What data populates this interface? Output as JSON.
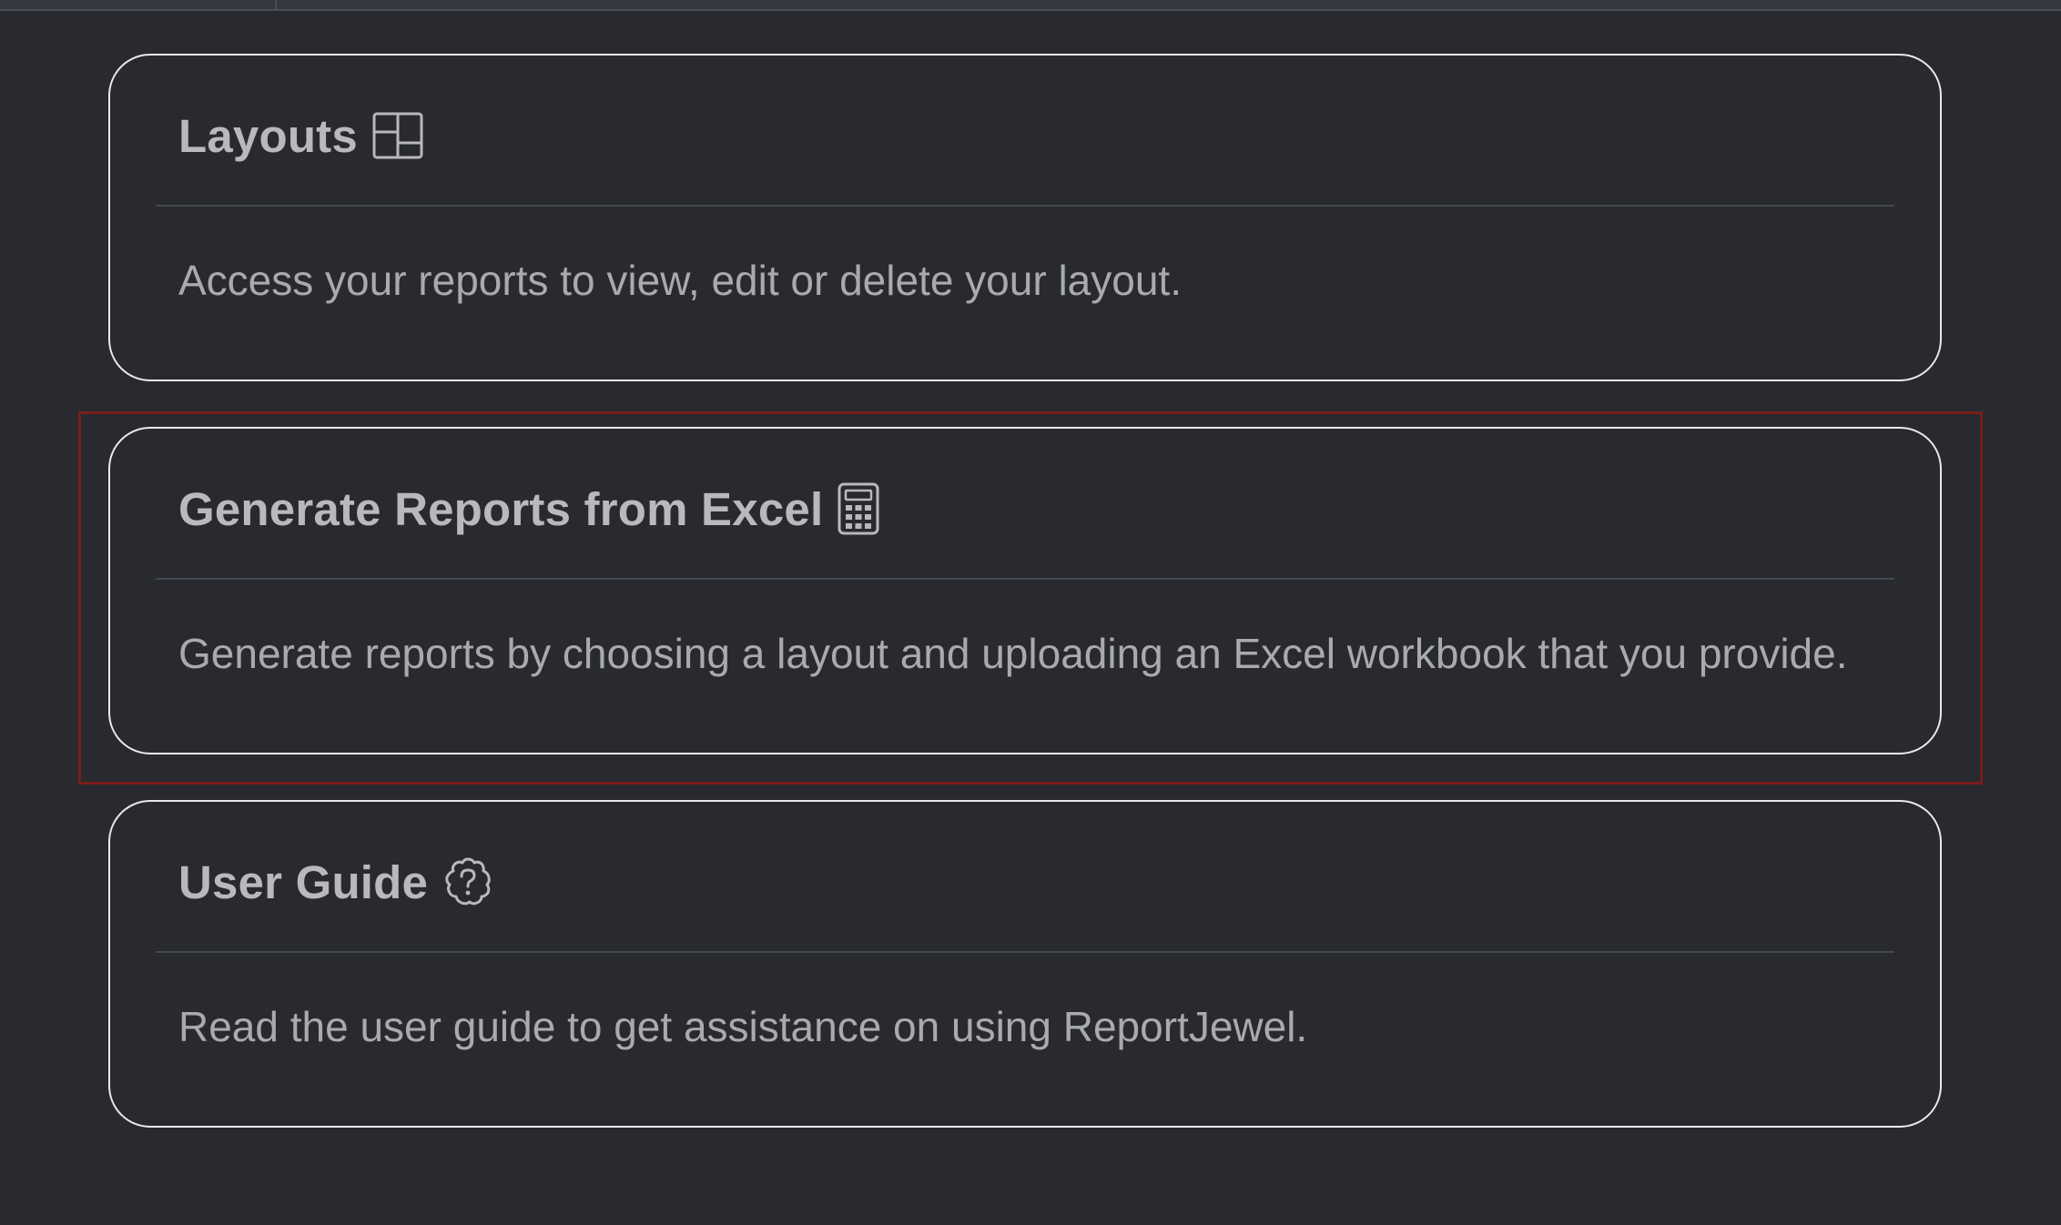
{
  "cards": [
    {
      "title": "Layouts",
      "icon": "layout-icon",
      "description": "Access your reports to view, edit or delete your layout."
    },
    {
      "title": "Generate Reports from Excel",
      "icon": "calculator-icon",
      "description": "Generate reports by choosing a layout and uploading an Excel workbook that you provide."
    },
    {
      "title": "User Guide",
      "icon": "help-badge-icon",
      "description": "Read the user guide to get assistance on using ReportJewel."
    }
  ],
  "colors": {
    "background": "#282a2f",
    "card_border": "#e9e9ea",
    "title_text": "#b9b9bb",
    "desc_text": "#a9aaac",
    "highlight": "#7a1d1a"
  }
}
